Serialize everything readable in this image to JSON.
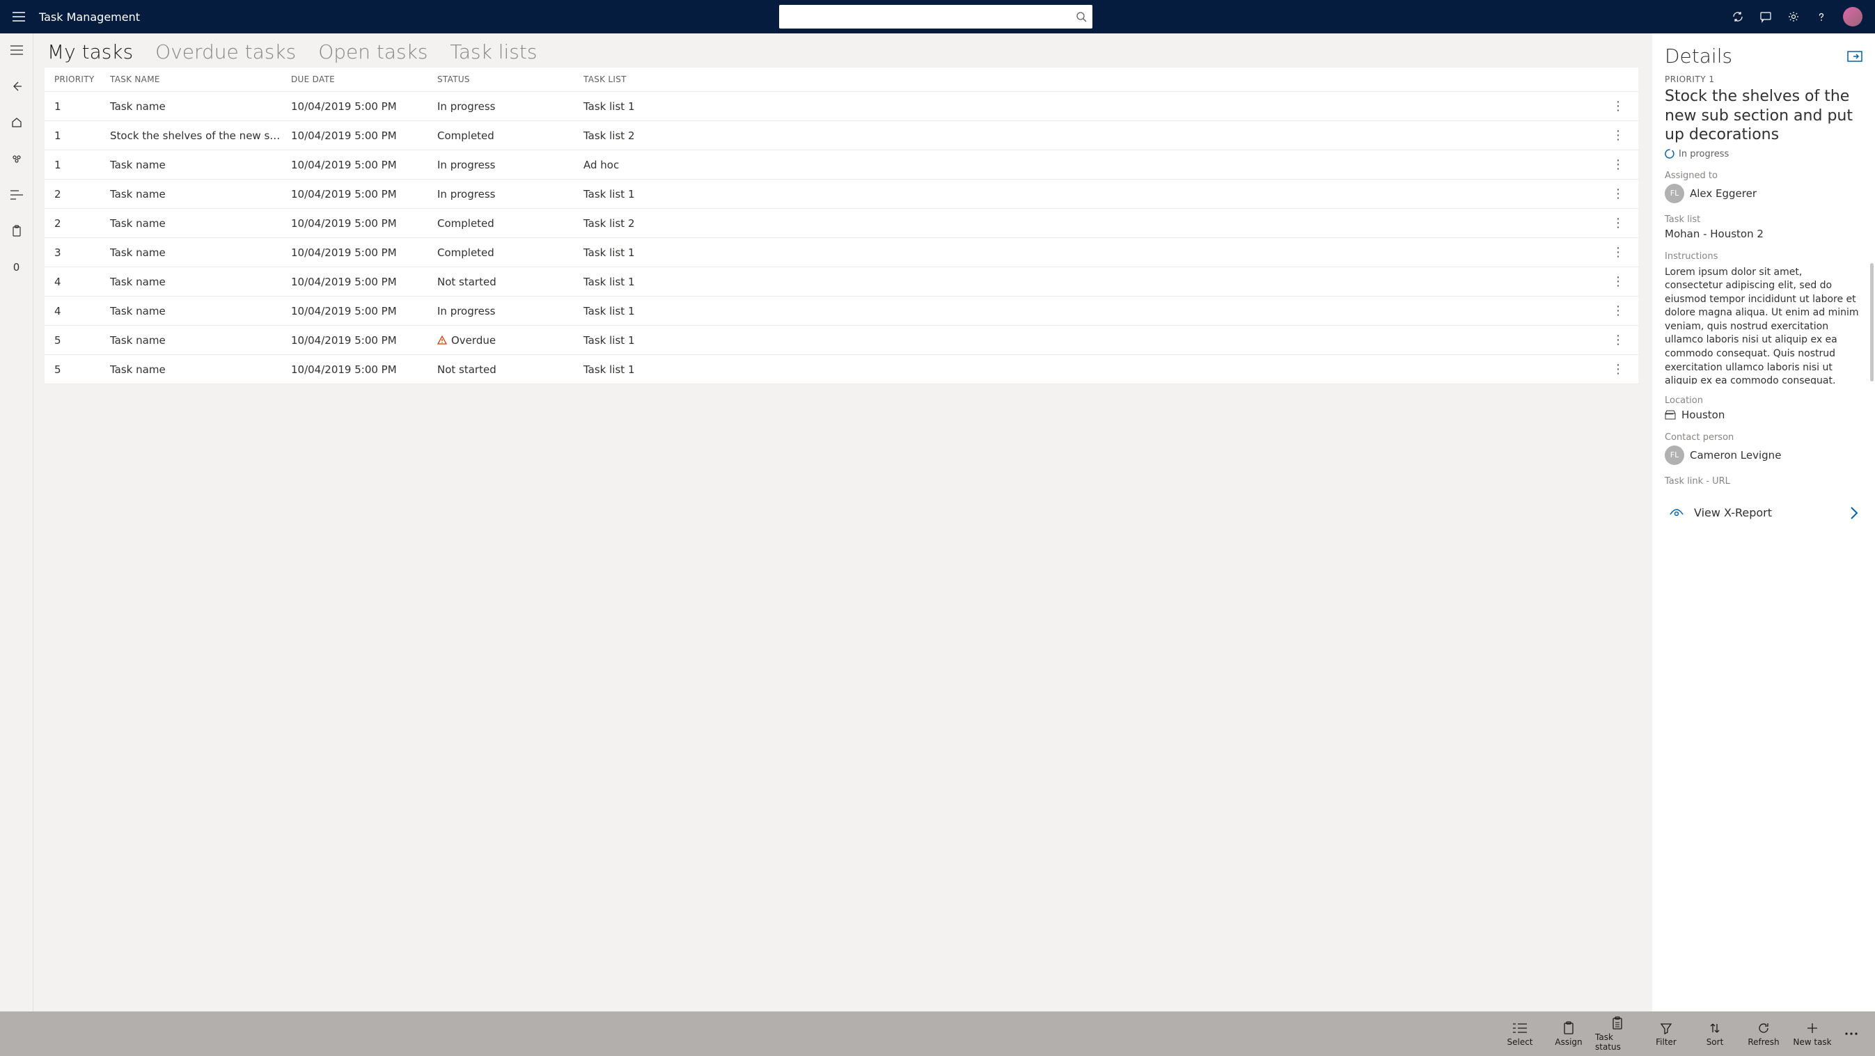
{
  "header": {
    "title": "Task Management",
    "search_placeholder": ""
  },
  "tabs": [
    {
      "label": "My tasks",
      "active": true
    },
    {
      "label": "Overdue tasks",
      "active": false
    },
    {
      "label": "Open tasks",
      "active": false
    },
    {
      "label": "Task lists",
      "active": false
    }
  ],
  "columns": {
    "priority": "PRIORITY",
    "name": "TASK NAME",
    "due": "DUE DATE",
    "status": "STATUS",
    "list": "TASK LIST"
  },
  "rows": [
    {
      "priority": "1",
      "name": "Task name",
      "due": "10/04/2019 5:00 PM",
      "status": "In progress",
      "list": "Task list 1",
      "alert": false
    },
    {
      "priority": "1",
      "name": "Stock the shelves of the new sub section...",
      "due": "10/04/2019 5:00 PM",
      "status": "Completed",
      "list": "Task list 2",
      "alert": false
    },
    {
      "priority": "1",
      "name": "Task name",
      "due": "10/04/2019 5:00 PM",
      "status": "In progress",
      "list": "Ad hoc",
      "alert": false
    },
    {
      "priority": "2",
      "name": "Task name",
      "due": "10/04/2019 5:00 PM",
      "status": "In progress",
      "list": "Task list 1",
      "alert": false
    },
    {
      "priority": "2",
      "name": "Task name",
      "due": "10/04/2019 5:00 PM",
      "status": "Completed",
      "list": "Task list 2",
      "alert": false
    },
    {
      "priority": "3",
      "name": "Task name",
      "due": "10/04/2019 5:00 PM",
      "status": "Completed",
      "list": "Task list 1",
      "alert": false
    },
    {
      "priority": "4",
      "name": "Task name",
      "due": "10/04/2019 5:00 PM",
      "status": "Not started",
      "list": "Task list 1",
      "alert": false
    },
    {
      "priority": "4",
      "name": "Task name",
      "due": "10/04/2019 5:00 PM",
      "status": "In progress",
      "list": "Task list 1",
      "alert": false
    },
    {
      "priority": "5",
      "name": "Task name",
      "due": "10/04/2019 5:00 PM",
      "status": "Overdue",
      "list": "Task list 1",
      "alert": true
    },
    {
      "priority": "5",
      "name": "Task name",
      "due": "10/04/2019 5:00 PM",
      "status": "Not started",
      "list": "Task list 1",
      "alert": false
    }
  ],
  "details": {
    "heading": "Details",
    "priority_label": "PRIORITY 1",
    "title": "Stock the shelves of the new sub section and put up decorations",
    "status": "In progress",
    "assigned_label": "Assigned to",
    "assigned_initials": "FL",
    "assigned_name": "Alex Eggerer",
    "tasklist_label": "Task list",
    "tasklist_value": "Mohan - Houston 2",
    "instructions_label": "Instructions",
    "instructions_text": "Lorem ipsum dolor sit amet, consectetur adipiscing elit, sed do eiusmod tempor incididunt ut labore et dolore magna aliqua. Ut enim ad minim veniam, quis nostrud exercitation ullamco laboris nisi ut aliquip ex ea commodo consequat. Quis nostrud exercitation ullamco laboris nisi ut aliquip ex ea commodo consequat. Lorem upsum dolor sit amet, consectetur Quis nostrud exercitation ullamco laboris nisi ut",
    "location_label": "Location",
    "location_value": "Houston",
    "contact_label": "Contact person",
    "contact_initials": "FL",
    "contact_name": "Cameron Levigne",
    "link_label": "Task link - URL",
    "link_action": "View X-Report"
  },
  "commands": {
    "select": "Select",
    "assign": "Assign",
    "task_status": "Task status",
    "filter": "Filter",
    "sort": "Sort",
    "refresh": "Refresh",
    "new_task": "New task"
  },
  "leftrail_zero": "0"
}
